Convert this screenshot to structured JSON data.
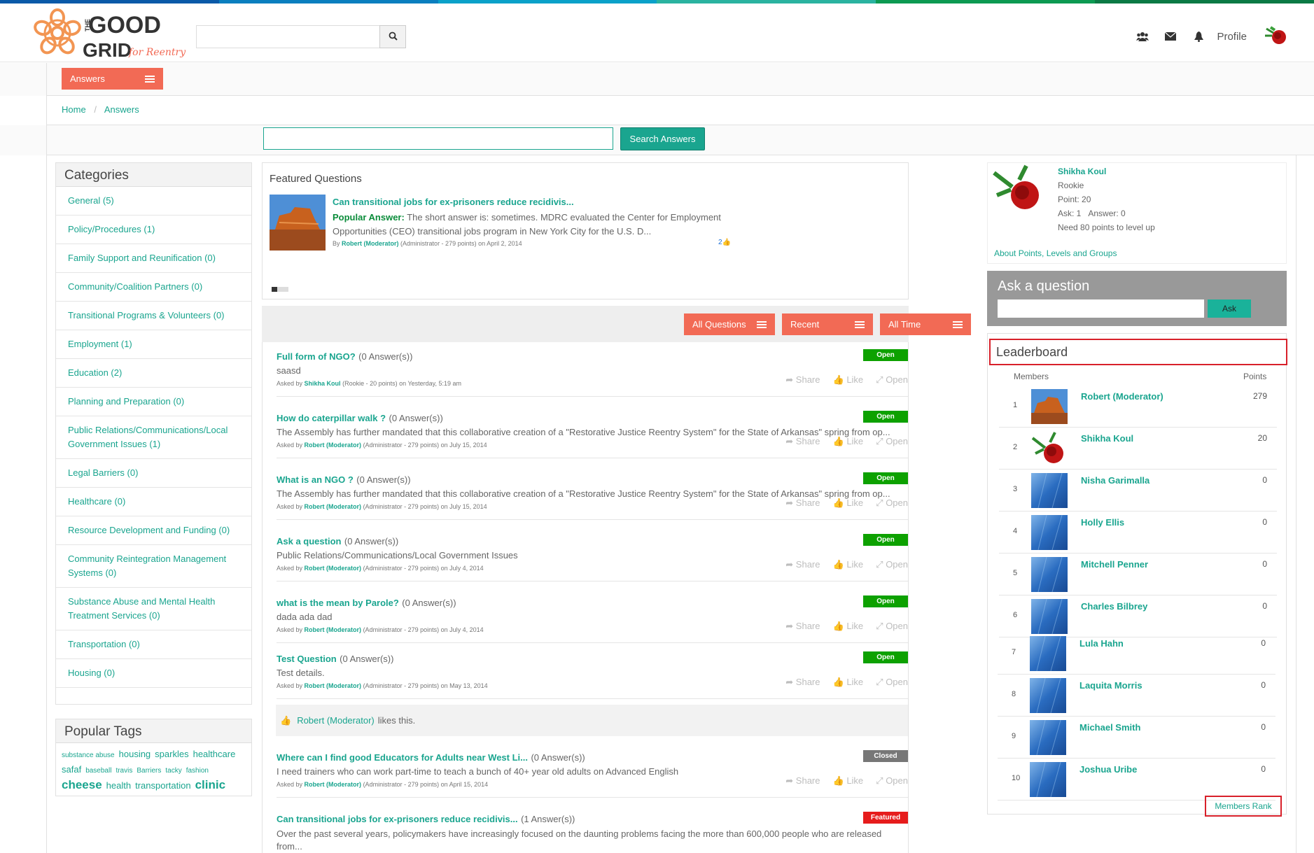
{
  "colors": {
    "accent": "#1aa58f",
    "orange": "#f26a55",
    "green": "#0da100",
    "grey_badge": "#777777",
    "red": "#e61c1c"
  },
  "logo": {
    "word1": "THE",
    "word2": "GOOD",
    "word3": "GRID",
    "script": "for Reentry"
  },
  "header": {
    "search_placeholder": "",
    "profile_label": "Profile"
  },
  "section": {
    "dropdown_label": "Answers"
  },
  "breadcrumb": {
    "home": "Home",
    "separator": "/",
    "current": "Answers"
  },
  "answer_search": {
    "placeholder": "",
    "button": "Search Answers"
  },
  "categories": {
    "title": "Categories",
    "items": [
      "General (5)",
      "Policy/Procedures (1)",
      "Family Support and Reunification (0)",
      "Community/Coalition Partners (0)",
      "Transitional Programs & Volunteers (0)",
      "Employment (1)",
      "Education (2)",
      "Planning and Preparation (0)",
      "Public Relations/Communications/Local Government Issues (1)",
      "Legal Barriers (0)",
      "Healthcare (0)",
      "Resource Development and Funding (0)",
      "Community Reintegration Management Systems (0)",
      "Substance Abuse and Mental Health Treatment Services (0)",
      "Transportation (0)",
      "Housing (0)"
    ]
  },
  "tags": {
    "title": "Popular Tags",
    "items": [
      "substance abuse",
      "housing",
      "sparkles",
      "healthcare",
      "safaf",
      "baseball",
      "travis",
      "Barriers",
      "tacky",
      "fashion",
      "cheese",
      "health",
      "transportation",
      "clinic"
    ]
  },
  "featured": {
    "title": "Featured Questions",
    "question": "Can transitional jobs for ex-prisoners reduce recidivis...",
    "popular_label": "Popular Answer:",
    "answer_text": "The short answer is: sometimes. MDRC evaluated the Center for Employment Opportunities (CEO) transitional jobs program in New York City for the U.S. D...",
    "by_label": "By",
    "author": "Robert (Moderator)",
    "author_meta": "(Administrator - 279 points)",
    "date": "on April 2, 2014",
    "likes": "2"
  },
  "filters": {
    "questions": "All Questions",
    "sort": "Recent",
    "period": "All Time"
  },
  "question_list": [
    {
      "title": "Full form of NGO?",
      "count": "(0 Answer(s))",
      "body": "saasd",
      "asked_by": "Asked by",
      "author": "Shikha Koul",
      "meta": "(Rookie - 20 points) on Yesterday, 5:19 am",
      "badge": "Open"
    },
    {
      "title": "How do caterpillar walk ?",
      "count": "(0 Answer(s))",
      "body": "The Assembly has further mandated that this collaborative creation of a \"Restorative Justice Reentry System\" for the State of Arkansas\" spring from op...",
      "asked_by": "Asked by",
      "author": "Robert (Moderator)",
      "meta": "(Administrator - 279 points) on July 15, 2014",
      "badge": "Open"
    },
    {
      "title": "What is an NGO ?",
      "count": "(0 Answer(s))",
      "body": "The Assembly has further mandated that this collaborative creation of a \"Restorative Justice Reentry System\" for the State of Arkansas\" spring from op...",
      "asked_by": "Asked by",
      "author": "Robert (Moderator)",
      "meta": "(Administrator - 279 points) on July 15, 2014",
      "badge": "Open"
    },
    {
      "title": "Ask a question",
      "count": "(0 Answer(s))",
      "body": "Public Relations/Communications/Local Government Issues",
      "asked_by": "Asked by",
      "author": "Robert (Moderator)",
      "meta": "(Administrator - 279 points) on July 4, 2014",
      "badge": "Open"
    },
    {
      "title": "what is the mean by Parole?",
      "count": "(0 Answer(s))",
      "body": "dada ada dad",
      "asked_by": "Asked by",
      "author": "Robert (Moderator)",
      "meta": "(Administrator - 279 points) on July 4, 2014",
      "badge": "Open"
    },
    {
      "title": "Test Question",
      "count": "(0 Answer(s))",
      "body": "Test details.",
      "asked_by": "Asked by",
      "author": "Robert (Moderator)",
      "meta": "(Administrator - 279 points) on May 13, 2014",
      "badge": "Open"
    },
    {
      "title": "Where can I find good Educators for Adults near West Li...",
      "count": "(0 Answer(s))",
      "body": "I need trainers who can work part-time to teach a bunch of 40+ year old adults on Advanced English",
      "asked_by": "Asked by",
      "author": "Robert (Moderator)",
      "meta": "(Administrator - 279 points) on April 15, 2014",
      "badge": "Closed"
    },
    {
      "title": "Can transitional jobs for ex-prisoners reduce recidivis...",
      "count": "(1 Answer(s))",
      "body": "Over the past several years, policymakers have increasingly focused on the daunting problems facing the more than 600,000 people who are released from...",
      "asked_by": "",
      "author": "",
      "meta": "",
      "badge": "Featured"
    }
  ],
  "actions": {
    "share": "Share",
    "like": "Like",
    "open": "Open"
  },
  "likes_box": {
    "user": "Robert (Moderator)",
    "text": "likes this."
  },
  "profile": {
    "name": "Shikha Koul",
    "rank": "Rookie",
    "points": "Point: 20",
    "ask": "Ask: 1",
    "answer": "Answer: 0",
    "level": "Need 80 points to level up",
    "about_link": "About Points, Levels and Groups"
  },
  "ask_box": {
    "title": "Ask a question",
    "placeholder": "",
    "button": "Ask"
  },
  "leaderboard": {
    "title": "Leaderboard",
    "col_members": "Members",
    "col_points": "Points",
    "rows": [
      {
        "rank": "1",
        "name": "Robert (Moderator)",
        "points": "279",
        "avatar": "canyon"
      },
      {
        "rank": "2",
        "name": "Shikha Koul",
        "points": "20",
        "avatar": "rose"
      },
      {
        "rank": "3",
        "name": "Nisha Garimalla",
        "points": "0",
        "avatar": "blue"
      },
      {
        "rank": "4",
        "name": "Holly Ellis",
        "points": "0",
        "avatar": "blue"
      },
      {
        "rank": "5",
        "name": "Mitchell Penner",
        "points": "0",
        "avatar": "blue"
      },
      {
        "rank": "6",
        "name": "Charles Bilbrey",
        "points": "0",
        "avatar": "blue"
      },
      {
        "rank": "7",
        "name": "Lula Hahn",
        "points": "0",
        "avatar": "blue"
      },
      {
        "rank": "8",
        "name": "Laquita Morris",
        "points": "0",
        "avatar": "blue"
      },
      {
        "rank": "9",
        "name": "Michael Smith",
        "points": "0",
        "avatar": "blue"
      },
      {
        "rank": "10",
        "name": "Joshua Uribe",
        "points": "0",
        "avatar": "blue"
      }
    ],
    "members_rank_link": "Members Rank"
  }
}
